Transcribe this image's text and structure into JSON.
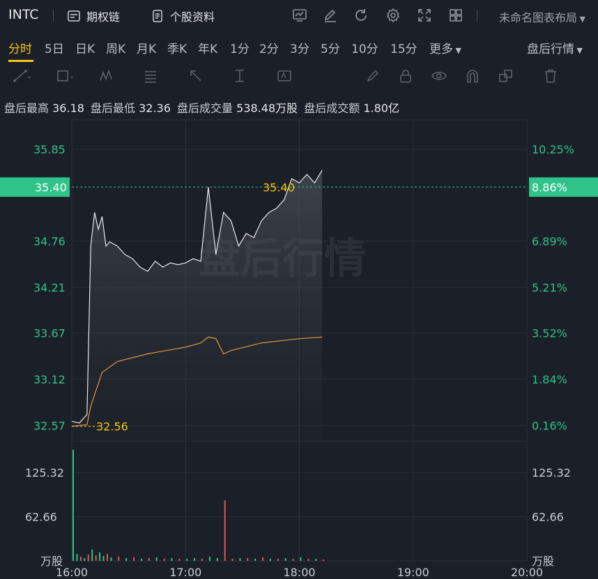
{
  "header": {
    "ticker": "INTC",
    "options_chain_label": "期权链",
    "profile_label": "个股资料",
    "layout_label": "未命名图表布局"
  },
  "tabs": [
    "分时",
    "5日",
    "日K",
    "周K",
    "月K",
    "季K",
    "年K",
    "1分",
    "2分",
    "3分",
    "5分",
    "10分",
    "15分",
    "更多"
  ],
  "active_tab": "分时",
  "session_selector": "盘后行情",
  "stats": {
    "high_label": "盘后最高",
    "high": "36.18",
    "low_label": "盘后最低",
    "low": "32.36",
    "volume_label": "盘后成交量",
    "volume": "538.48万股",
    "turnover_label": "盘后成交额",
    "turnover": "1.80亿"
  },
  "watermark": "盘后行情",
  "colors": {
    "up": "#2fc38a",
    "down": "#e0555a",
    "accent": "#f5c518",
    "avg_line": "#e09a3c",
    "price_line": "#e8e8e8"
  },
  "chart_data": {
    "type": "line",
    "title": "",
    "price_axis": {
      "left_labels": [
        "35.85",
        "34.76",
        "34.21",
        "33.67",
        "33.12",
        "32.57"
      ],
      "left_values": [
        35.85,
        34.76,
        34.21,
        33.67,
        33.12,
        32.57
      ],
      "right_labels": [
        "10.25%",
        "6.89%",
        "5.21%",
        "3.52%",
        "1.84%",
        "0.16%"
      ]
    },
    "current_price": {
      "price": "35.40",
      "pct": "8.86%"
    },
    "open_marker": "32.56",
    "x_ticks": [
      "16:00",
      "17:00",
      "18:00",
      "19:00",
      "20:00"
    ],
    "x_range": [
      "16:00",
      "20:00"
    ],
    "ylim": [
      32.4,
      36.2
    ],
    "series": [
      {
        "type": "price",
        "x": [
          "16:00",
          "16:04",
          "16:08",
          "16:10",
          "16:12",
          "16:14",
          "16:16",
          "16:18",
          "16:20",
          "16:24",
          "16:28",
          "16:32",
          "16:36",
          "16:40",
          "16:44",
          "16:48",
          "16:52",
          "16:56",
          "17:00",
          "17:04",
          "17:08",
          "17:12",
          "17:16",
          "17:20",
          "17:24",
          "17:28",
          "17:32",
          "17:36",
          "17:40",
          "17:44",
          "17:48",
          "17:52",
          "17:56",
          "18:00",
          "18:04",
          "18:08",
          "18:12"
        ],
        "values": [
          32.62,
          32.6,
          32.7,
          34.7,
          35.1,
          34.9,
          35.05,
          34.7,
          34.75,
          34.7,
          34.6,
          34.55,
          34.45,
          34.4,
          34.52,
          34.45,
          34.5,
          34.48,
          34.5,
          34.55,
          34.52,
          35.4,
          34.6,
          35.1,
          35.0,
          34.7,
          34.85,
          34.8,
          35.0,
          35.1,
          35.15,
          35.25,
          35.5,
          35.45,
          35.55,
          35.45,
          35.6
        ]
      },
      {
        "type": "average",
        "x": [
          "16:00",
          "16:08",
          "16:10",
          "16:16",
          "16:24",
          "16:40",
          "17:00",
          "17:08",
          "17:12",
          "17:16",
          "17:20",
          "17:24",
          "17:40",
          "18:00",
          "18:12"
        ],
        "values": [
          32.56,
          32.58,
          32.8,
          33.2,
          33.33,
          33.42,
          33.5,
          33.55,
          33.62,
          33.6,
          33.42,
          33.46,
          33.55,
          33.6,
          33.62
        ]
      }
    ],
    "volume_axis": {
      "labels": [
        "125.32",
        "62.66"
      ],
      "unit": "万股"
    },
    "volume_bars": {
      "times": [
        "16:00",
        "16:02",
        "16:04",
        "16:06",
        "16:08",
        "16:10",
        "16:12",
        "16:14",
        "16:16",
        "16:18",
        "16:20",
        "16:24",
        "16:28",
        "16:32",
        "16:36",
        "16:40",
        "16:44",
        "16:48",
        "16:52",
        "16:56",
        "17:00",
        "17:04",
        "17:08",
        "17:12",
        "17:16",
        "17:20",
        "17:24",
        "17:28",
        "17:32",
        "17:36",
        "17:40",
        "17:44",
        "17:48",
        "17:52",
        "17:56",
        "18:00",
        "18:04",
        "18:08",
        "18:12"
      ],
      "values": [
        158,
        10,
        6,
        4,
        9,
        16,
        8,
        12,
        7,
        10,
        5,
        6,
        4,
        5,
        3,
        4,
        5,
        3,
        4,
        3,
        3,
        4,
        3,
        6,
        4,
        86,
        3,
        4,
        4,
        3,
        5,
        3,
        3,
        4,
        3,
        5,
        3,
        3,
        2
      ],
      "colors": [
        "up",
        "up",
        "down",
        "up",
        "down",
        "up",
        "down",
        "up",
        "up",
        "down",
        "up",
        "down",
        "up",
        "down",
        "up",
        "down",
        "up",
        "down",
        "up",
        "down",
        "up",
        "up",
        "down",
        "up",
        "up",
        "down",
        "down",
        "up",
        "down",
        "up",
        "down",
        "up",
        "down",
        "up",
        "down",
        "up",
        "down",
        "up",
        "down"
      ]
    }
  }
}
